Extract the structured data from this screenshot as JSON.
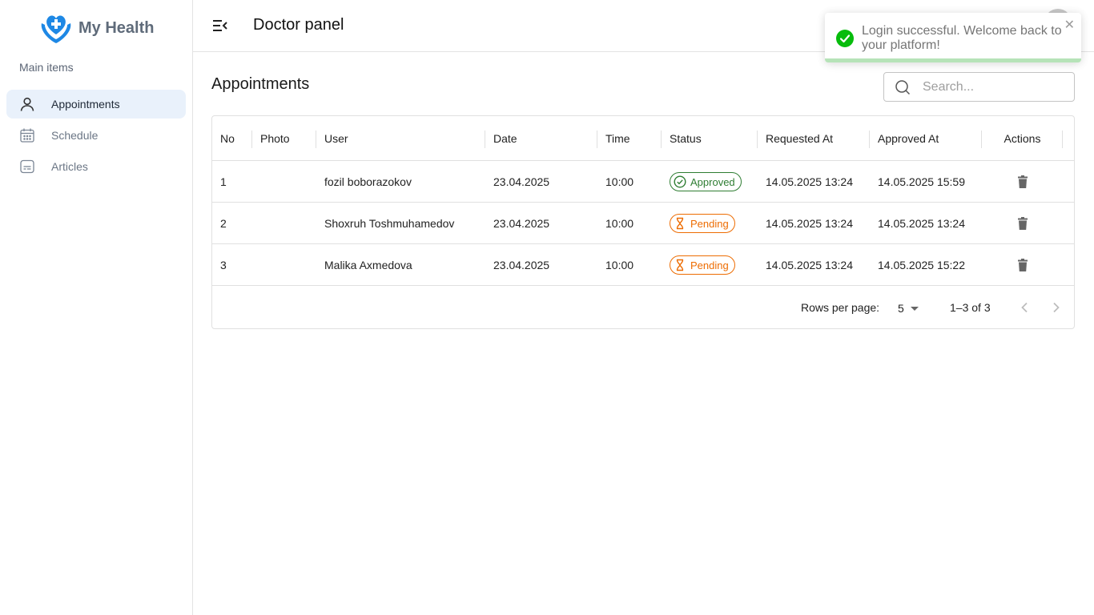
{
  "app": {
    "name": "My Health"
  },
  "sidebar": {
    "section_title": "Main items",
    "items": [
      {
        "label": "Appointments",
        "icon": "person-icon",
        "active": true
      },
      {
        "label": "Schedule",
        "icon": "calendar-icon",
        "active": false
      },
      {
        "label": "Articles",
        "icon": "article-icon",
        "active": false
      }
    ]
  },
  "header": {
    "title": "Doctor panel"
  },
  "toast": {
    "message": "Login successful. Welcome back to your platform!",
    "type": "success",
    "close_label": "✕"
  },
  "main": {
    "heading": "Appointments",
    "search": {
      "placeholder": "Search...",
      "value": ""
    }
  },
  "table": {
    "columns": [
      "No",
      "Photo",
      "User",
      "Date",
      "Time",
      "Status",
      "Requested At",
      "Approved At",
      "Actions"
    ],
    "rows": [
      {
        "no": "1",
        "photo": "",
        "user": "fozil boborazokov",
        "date": "23.04.2025",
        "time": "10:00",
        "status": "Approved",
        "requested_at": "14.05.2025 13:24",
        "approved_at": "14.05.2025 15:59"
      },
      {
        "no": "2",
        "photo": "",
        "user": "Shoxruh Toshmuhamedov",
        "date": "23.04.2025",
        "time": "10:00",
        "status": "Pending",
        "requested_at": "14.05.2025 13:24",
        "approved_at": "14.05.2025 13:24"
      },
      {
        "no": "3",
        "photo": "",
        "user": "Malika Axmedova",
        "date": "23.04.2025",
        "time": "10:00",
        "status": "Pending",
        "requested_at": "14.05.2025 13:24",
        "approved_at": "14.05.2025 15:22"
      }
    ]
  },
  "pagination": {
    "rows_per_page_label": "Rows per page:",
    "rows_per_page": "5",
    "range": "1–3 of 3"
  },
  "colors": {
    "primary": "#1976d2",
    "success": "#2e7d32",
    "warning": "#ed6c02",
    "toast_success": "#07bc0c",
    "logo": "#1e88e5"
  }
}
